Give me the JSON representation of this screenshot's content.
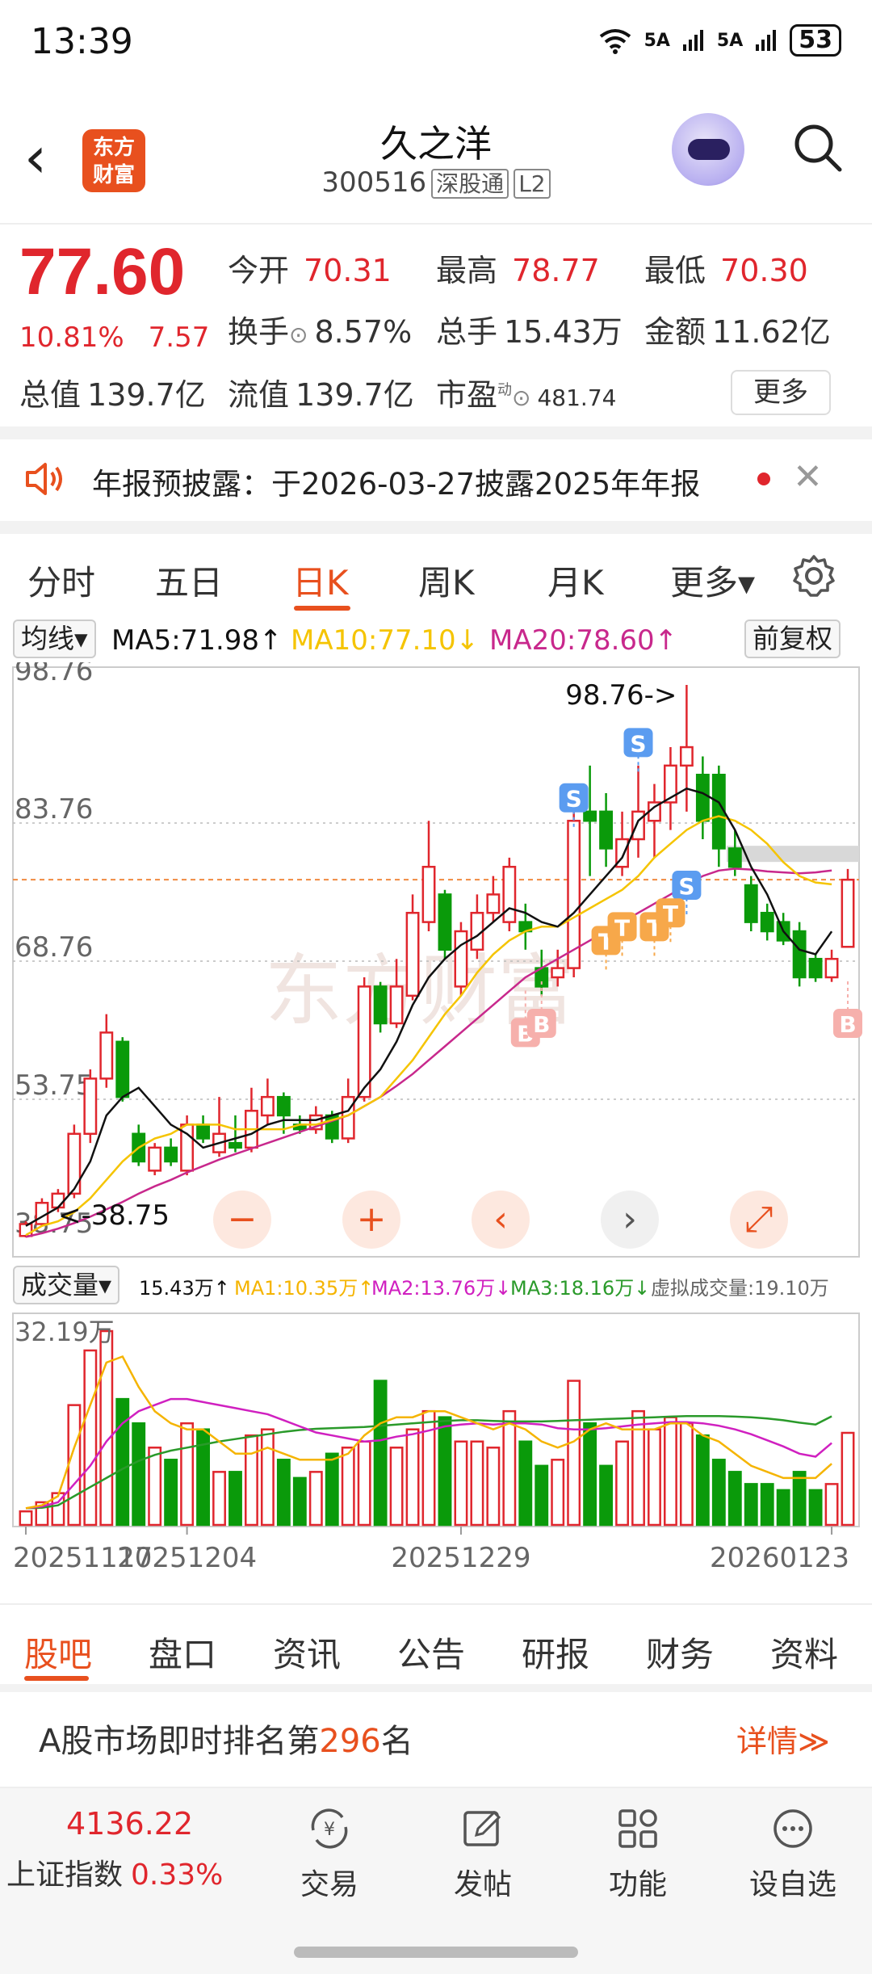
{
  "status": {
    "time": "13:39",
    "net1": "5A",
    "net2": "5A",
    "battery": "53"
  },
  "header": {
    "title": "久之洋",
    "code": "300516",
    "exchange_tag": "深股通",
    "level_tag": "L2",
    "logo_line1": "东方",
    "logo_line2": "财富"
  },
  "quote": {
    "price": "77.60",
    "change_pct": "10.81%",
    "change_amt": "7.57",
    "open_label": "今开",
    "open": "70.31",
    "high_label": "最高",
    "high": "78.77",
    "low_label": "最低",
    "low": "70.30",
    "turnover_label": "换手",
    "turnover": "8.57%",
    "volume_label": "总手",
    "volume": "15.43万",
    "amount_label": "金额",
    "amount": "11.62亿",
    "mktcap_label": "总值",
    "mktcap": "139.7亿",
    "float_label": "流值",
    "float_cap": "139.7亿",
    "pe_label": "市盈",
    "pe_sup": "动",
    "pe": "481.74",
    "more_label": "更多"
  },
  "notice": {
    "text": "年报预披露：于2026-03-27披露2025年年报"
  },
  "tabs": [
    {
      "label": "分时"
    },
    {
      "label": "五日"
    },
    {
      "label": "日K"
    },
    {
      "label": "周K"
    },
    {
      "label": "月K"
    },
    {
      "label": "更多▾"
    }
  ],
  "ma": {
    "selector": "均线▾",
    "ma5": "MA5:71.98↑",
    "ma10": "MA10:77.10↓",
    "ma20": "MA20:78.60↑",
    "adjust": "前复权",
    "colors": {
      "ma5": "#111111",
      "ma10": "#f5c400",
      "ma20": "#c8288c"
    }
  },
  "vol_ind": {
    "selector": "成交量▾",
    "vol": "15.43万↑",
    "ma1": "MA1:10.35万↑",
    "ma2": "MA2:13.76万↓",
    "ma3": "MA3:18.16万↓",
    "virtual": "虚拟成交量:19.10万",
    "colors": {
      "ma1": "#f5b400",
      "ma2": "#d020c0",
      "ma3": "#2a9a2a"
    }
  },
  "chart_data": {
    "type": "candlestick",
    "y_labels": [
      "98.76",
      "83.76",
      "68.76",
      "53.75",
      "38.75"
    ],
    "ylim": [
      38.75,
      98.76
    ],
    "max_annotation": "98.76->",
    "min_annotation": "<-38.75",
    "current_price_line": 77.6,
    "x_labels": [
      "20251117",
      "20251204",
      "20251229",
      "20260123"
    ],
    "vol_max_label": "32.19万",
    "watermark": "东方财富",
    "colors": {
      "up": "#e0262d",
      "down": "#0a9a0a"
    },
    "candles": [
      [
        38.9,
        40.2,
        40.5,
        38.75,
        2.5
      ],
      [
        40.2,
        42.5,
        43.0,
        40.0,
        4.0
      ],
      [
        42.0,
        43.5,
        44.0,
        41.5,
        5.5
      ],
      [
        43.5,
        50.0,
        51.0,
        43.0,
        20.0
      ],
      [
        50.0,
        56.0,
        57.0,
        49.0,
        29.0
      ],
      [
        56.0,
        61.0,
        63.0,
        55.0,
        32.19
      ],
      [
        60.0,
        54.0,
        60.5,
        53.5,
        21.0
      ],
      [
        50.0,
        47.0,
        51.0,
        46.5,
        17.0
      ],
      [
        46.0,
        48.5,
        49.0,
        45.5,
        13.0
      ],
      [
        48.5,
        47.0,
        49.5,
        46.5,
        11.0
      ],
      [
        46.0,
        51.0,
        52.0,
        45.5,
        17.0
      ],
      [
        51.0,
        49.5,
        52.0,
        49.0,
        16.0
      ],
      [
        48.0,
        50.0,
        54.0,
        47.5,
        9.0
      ],
      [
        49.0,
        48.5,
        52.0,
        48.0,
        9.0
      ],
      [
        48.5,
        52.5,
        55.0,
        48.0,
        15.0
      ],
      [
        52.0,
        54.0,
        56.0,
        51.0,
        16.0
      ],
      [
        54.0,
        52.0,
        54.5,
        50.0,
        11.0
      ],
      [
        51.0,
        50.5,
        52.0,
        50.0,
        8.0
      ],
      [
        50.5,
        52.0,
        53.0,
        50.0,
        9.0
      ],
      [
        52.0,
        49.5,
        52.5,
        49.0,
        12.0
      ],
      [
        49.5,
        54.0,
        56.0,
        49.0,
        13.0
      ],
      [
        54.0,
        66.0,
        67.0,
        53.5,
        14.0
      ],
      [
        66.0,
        62.0,
        66.5,
        61.0,
        24.0
      ],
      [
        62.0,
        66.0,
        69.0,
        61.5,
        13.0
      ],
      [
        65.0,
        74.0,
        76.0,
        64.5,
        16.0
      ],
      [
        73.0,
        79.0,
        84.0,
        72.0,
        19.0
      ],
      [
        76.0,
        70.0,
        76.5,
        69.0,
        18.0
      ],
      [
        66.0,
        72.0,
        73.0,
        65.0,
        14.0
      ],
      [
        70.0,
        74.0,
        76.0,
        69.0,
        14.0
      ],
      [
        74.0,
        76.0,
        78.0,
        73.0,
        13.0
      ],
      [
        73.0,
        79.0,
        80.0,
        72.0,
        19.0
      ],
      [
        73.0,
        72.0,
        75.0,
        70.0,
        14.0
      ],
      [
        68.0,
        66.0,
        70.0,
        65.0,
        10.0
      ],
      [
        67.0,
        68.0,
        70.0,
        66.0,
        11.0
      ],
      [
        68.0,
        84.0,
        85.0,
        67.0,
        24.0
      ],
      [
        85.0,
        84.0,
        90.0,
        78.0,
        17.0
      ],
      [
        85.0,
        81.0,
        87.0,
        79.0,
        10.0
      ],
      [
        79.0,
        82.0,
        85.0,
        78.0,
        14.0
      ],
      [
        82.0,
        85.0,
        90.0,
        80.0,
        19.0
      ],
      [
        84.0,
        86.0,
        88.0,
        80.0,
        16.0
      ],
      [
        86.0,
        90.0,
        92.0,
        83.0,
        18.0
      ],
      [
        90.0,
        92.0,
        98.76,
        85.0,
        17.0
      ],
      [
        89.0,
        84.0,
        91.0,
        82.0,
        15.0
      ],
      [
        89.0,
        81.0,
        90.0,
        79.0,
        11.0
      ],
      [
        81.0,
        79.0,
        83.0,
        78.0,
        9.0
      ],
      [
        77.0,
        73.0,
        78.0,
        72.0,
        7.0
      ],
      [
        74.0,
        72.0,
        75.0,
        71.0,
        7.0
      ],
      [
        73.0,
        71.0,
        74.0,
        70.5,
        6.0
      ],
      [
        72.0,
        67.0,
        73.0,
        66.0,
        9.0
      ],
      [
        69.0,
        67.0,
        69.5,
        66.5,
        6.0
      ],
      [
        67.0,
        69.0,
        70.0,
        66.5,
        7.0
      ],
      [
        70.31,
        77.6,
        78.77,
        70.3,
        15.43
      ]
    ],
    "ma5": [
      40,
      41,
      42,
      44,
      47,
      52,
      54,
      55,
      53,
      51,
      50,
      48.5,
      49,
      49.5,
      50,
      51,
      51.5,
      51.5,
      51.5,
      52,
      52.5,
      55,
      57,
      60,
      64,
      67,
      69,
      70.5,
      71.5,
      73,
      74.5,
      74,
      73,
      72.5,
      74,
      76,
      78,
      80,
      84,
      85.5,
      86.5,
      87.5,
      87,
      86,
      83,
      79,
      76,
      72,
      70,
      69.5,
      71.98
    ],
    "ma10": [
      39,
      40,
      40.5,
      41.5,
      43,
      45,
      47,
      48.5,
      49.5,
      50,
      51,
      51,
      51,
      50.5,
      50.5,
      50.5,
      50.5,
      51,
      51,
      51.5,
      52,
      53,
      54,
      56,
      58,
      60.5,
      63,
      65,
      67.5,
      69.5,
      71,
      72,
      72.5,
      72.5,
      73.5,
      74.5,
      75.5,
      76.5,
      78,
      80,
      81.5,
      83,
      84,
      84.5,
      84,
      83,
      81.5,
      79.5,
      78,
      77.3,
      77.1
    ],
    "ma20": [
      38.8,
      39.2,
      39.7,
      40.3,
      41,
      41.8,
      42.6,
      43.5,
      44.3,
      45,
      45.8,
      46.5,
      47.2,
      47.8,
      48.4,
      49,
      49.6,
      50.2,
      50.8,
      51.4,
      52,
      53,
      54,
      55.2,
      56.5,
      58,
      59.5,
      61,
      62.5,
      64,
      65.5,
      67,
      68,
      69,
      70,
      71,
      72,
      73,
      74,
      75,
      76,
      77,
      78,
      78.6,
      78.8,
      78.7,
      78.5,
      78.4,
      78.3,
      78.4,
      78.6
    ],
    "vma1": [
      3,
      3.5,
      5,
      13,
      20,
      27,
      28,
      23,
      19,
      17,
      16,
      16,
      14,
      12,
      12,
      13,
      12,
      11,
      11,
      11,
      12,
      15,
      17,
      18,
      18,
      19,
      19,
      18,
      17,
      16,
      17,
      16,
      14,
      13,
      14,
      16,
      17,
      16,
      16,
      16,
      17,
      17,
      15,
      14,
      12,
      10,
      9,
      8,
      8,
      8,
      10.35
    ],
    "vma2": [
      3,
      3.3,
      4,
      7,
      10,
      14,
      17,
      19,
      20,
      21,
      21,
      20.5,
      20,
      19.5,
      19,
      18.5,
      17.5,
      16.5,
      15.5,
      15,
      14.5,
      14,
      14.2,
      14.8,
      15.2,
      15.8,
      16.5,
      16.8,
      17,
      16.8,
      17,
      17,
      16.8,
      16.2,
      16,
      16,
      16.2,
      16.5,
      16.8,
      17,
      17.2,
      17.2,
      17,
      16.6,
      16,
      15.2,
      14.2,
      13.2,
      12,
      11.5,
      13.76
    ],
    "vma3": [
      3,
      3.1,
      3.5,
      5,
      6.5,
      8,
      9.5,
      10.8,
      11.8,
      12.5,
      13,
      13.5,
      14,
      14.4,
      14.8,
      15.2,
      15.6,
      15.9,
      16.1,
      16.2,
      16.3,
      16.4,
      16.6,
      16.8,
      17,
      17.2,
      17.4,
      17.5,
      17.5,
      17.4,
      17.3,
      17.3,
      17.3,
      17.4,
      17.5,
      17.6,
      17.7,
      17.8,
      17.9,
      18,
      18.1,
      18.2,
      18.2,
      18.2,
      18.1,
      18,
      17.8,
      17.5,
      17.1,
      16.8,
      18.16
    ],
    "markers": [
      {
        "type": "S",
        "index": 34,
        "price": 86.5
      },
      {
        "type": "S",
        "index": 38,
        "price": 92.5
      },
      {
        "type": "S",
        "index": 41,
        "price": 77.0
      },
      {
        "type": "T",
        "index": 36,
        "price": 71.0
      },
      {
        "type": "T",
        "index": 37,
        "price": 72.5
      },
      {
        "type": "T",
        "index": 39,
        "price": 72.5
      },
      {
        "type": "T",
        "index": 40,
        "price": 74.0
      },
      {
        "type": "B",
        "index": 31,
        "price": 61.0
      },
      {
        "type": "B",
        "index": 32,
        "price": 62.0
      },
      {
        "type": "B",
        "index": 51,
        "price": 62.0
      }
    ]
  },
  "bottom_tabs": [
    {
      "label": "股吧"
    },
    {
      "label": "盘口"
    },
    {
      "label": "资讯"
    },
    {
      "label": "公告"
    },
    {
      "label": "研报"
    },
    {
      "label": "财务"
    },
    {
      "label": "资料"
    }
  ],
  "rank": {
    "prefix": "A股市场即时排名第",
    "number": "296",
    "suffix": "名",
    "detail": "详情≫"
  },
  "bottom_bar": {
    "index_value": "4136.22",
    "index_name": "上证指数",
    "index_change": "0.33%",
    "items": [
      {
        "label": "交易",
        "icon": "trade-icon"
      },
      {
        "label": "发帖",
        "icon": "post-icon"
      },
      {
        "label": "功能",
        "icon": "grid-icon"
      },
      {
        "label": "设自选",
        "icon": "more-dots-icon"
      }
    ]
  }
}
